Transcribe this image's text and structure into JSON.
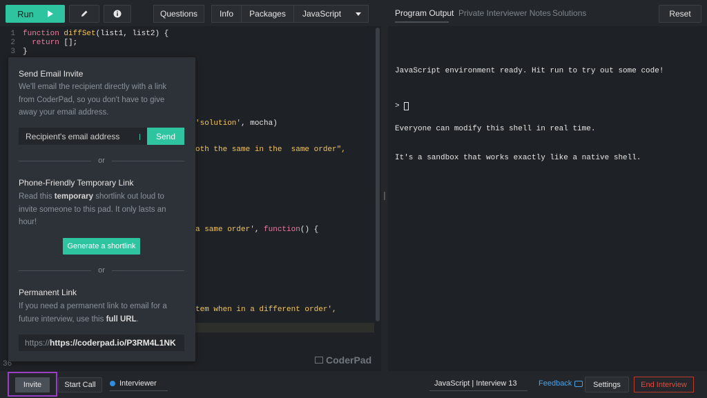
{
  "toolbar": {
    "run_label": "Run",
    "questions_label": "Questions",
    "info_label": "Info",
    "packages_label": "Packages",
    "language_label": "JavaScript"
  },
  "editor": {
    "line_numbers": [
      "1",
      "2",
      "3"
    ],
    "line1": {
      "kw": "function",
      "fn": "diffSet",
      "rest": "(list1, list2) {"
    },
    "line2": {
      "kw": "return",
      "rest": " [];"
    },
    "line3": "}",
    "frag_solution": {
      "str": "'solution'",
      "rest": ", mocha)"
    },
    "frag_same_order": "oth the same in the  same order\",",
    "frag_function": {
      "str": "a same order'",
      "mid": ", ",
      "kw": "function",
      "rest": "() {"
    },
    "frag_different": "tem when in a different order',",
    "line36": "36",
    "watermark": "CoderPad"
  },
  "right_panel": {
    "tabs": [
      "Program Output",
      "Private Interviewer Notes",
      "Solutions"
    ],
    "reset_label": "Reset",
    "console_lines": [
      "JavaScript environment ready. Hit run to try out some code!",
      "",
      "Everyone can modify this shell in real time.",
      "It's a sandbox that works exactly like a native shell."
    ],
    "prompt": ">"
  },
  "invite_popover": {
    "email_title": "Send Email Invite",
    "email_desc": "We'll email the recipient directly with a link from CoderPad, so you don't have to give away your email address.",
    "email_placeholder": "Recipient's email address",
    "send_label": "Send",
    "or_label": "or",
    "phone_title": "Phone-Friendly Temporary Link",
    "phone_desc_pre": "Read this ",
    "phone_desc_em": "temporary",
    "phone_desc_post": " shortlink out loud to invite someone to this pad. It only lasts an hour!",
    "shortlink_label": "Generate a shortlink",
    "perm_title": "Permanent Link",
    "perm_desc_pre": "If you need a permanent link to email for a future interview, use this ",
    "perm_desc_em": "full URL",
    "perm_desc_post": ".",
    "perm_prefix": "https://",
    "perm_url": "https://coderpad.io/P3RM4L1NK"
  },
  "bottom_bar": {
    "invite_label": "Invite",
    "call_label": "Start Call",
    "interviewer_label": "Interviewer",
    "status_label": "JavaScript | Interview 13",
    "feedback_label": "Feedback",
    "settings_label": "Settings",
    "end_label": "End Interview"
  },
  "colors": {
    "accent": "#2ec4a0",
    "danger": "#e04b3c",
    "link": "#4aa3e8",
    "highlight": "#9b3fc6"
  }
}
